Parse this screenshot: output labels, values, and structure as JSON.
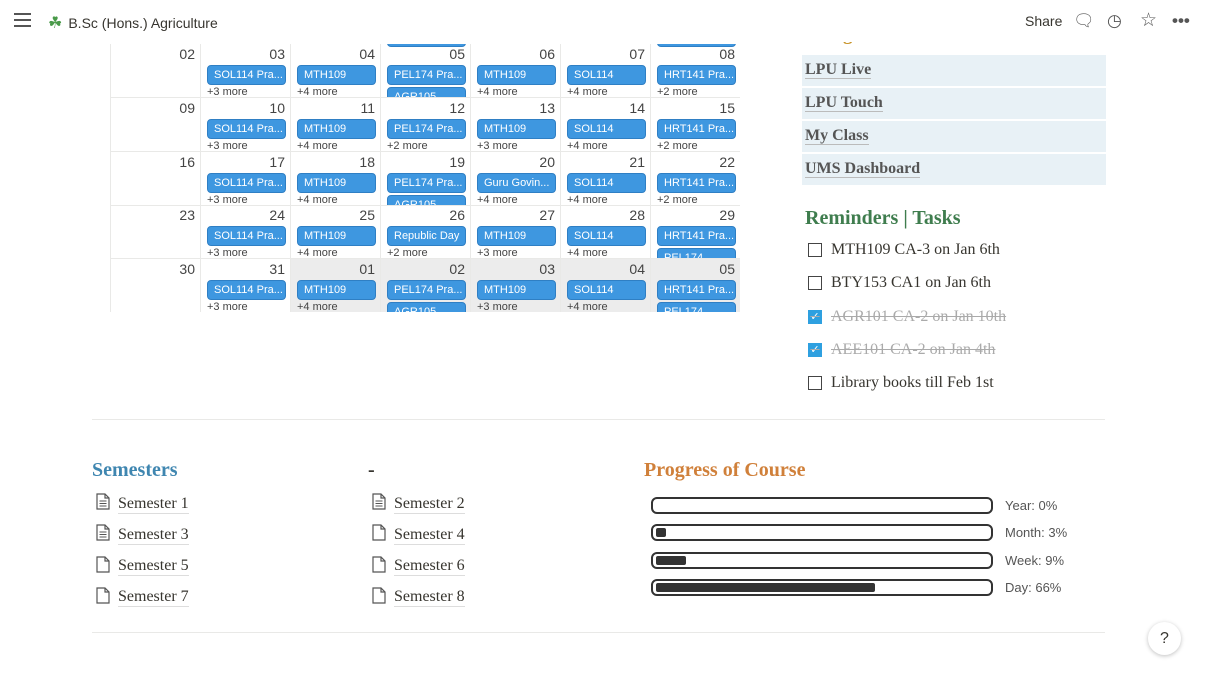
{
  "topbar": {
    "title": "B.Sc (Hons.) Agriculture",
    "share": "Share",
    "icons": [
      "menu-icon",
      "clover-icon",
      "comment-icon",
      "history-icon",
      "star-icon",
      "more-icon"
    ]
  },
  "calendar": {
    "event_color": "#3e97e0",
    "weeks": [
      [
        {
          "day": "02"
        },
        {
          "day": "03",
          "event": "SOL114 Pra...",
          "more": "+3 more"
        },
        {
          "day": "04",
          "event": "MTH109",
          "more": "+4 more"
        },
        {
          "day": "05",
          "event": "PEL174 Pra...",
          "extra": "AGR105"
        },
        {
          "day": "06",
          "event": "MTH109",
          "more": "+4 more"
        },
        {
          "day": "07",
          "event": "SOL114",
          "more": "+4 more"
        },
        {
          "day": "08",
          "event": "HRT141 Pra...",
          "more": "+2 more"
        }
      ],
      [
        {
          "day": "09"
        },
        {
          "day": "10",
          "event": "SOL114 Pra...",
          "more": "+3 more"
        },
        {
          "day": "11",
          "event": "MTH109",
          "more": "+4 more"
        },
        {
          "day": "12",
          "event": "PEL174 Pra...",
          "more": "+2 more"
        },
        {
          "day": "13",
          "event": "MTH109",
          "more": "+3 more"
        },
        {
          "day": "14",
          "event": "SOL114",
          "more": "+4 more"
        },
        {
          "day": "15",
          "event": "HRT141 Pra...",
          "more": "+2 more"
        }
      ],
      [
        {
          "day": "16"
        },
        {
          "day": "17",
          "event": "SOL114 Pra...",
          "more": "+3 more"
        },
        {
          "day": "18",
          "event": "MTH109",
          "more": "+4 more"
        },
        {
          "day": "19",
          "event": "PEL174 Pra...",
          "extra": "AGR105"
        },
        {
          "day": "20",
          "event": "Guru Govin...",
          "more": "+4 more"
        },
        {
          "day": "21",
          "event": "SOL114",
          "more": "+4 more"
        },
        {
          "day": "22",
          "event": "HRT141 Pra...",
          "more": "+2 more"
        }
      ],
      [
        {
          "day": "23"
        },
        {
          "day": "24",
          "event": "SOL114 Pra...",
          "more": "+3 more"
        },
        {
          "day": "25",
          "event": "MTH109",
          "more": "+4 more"
        },
        {
          "day": "26",
          "event": "Republic Day",
          "more": "+2 more"
        },
        {
          "day": "27",
          "event": "MTH109",
          "more": "+3 more"
        },
        {
          "day": "28",
          "event": "SOL114",
          "more": "+4 more"
        },
        {
          "day": "29",
          "event": "HRT141 Pra...",
          "extra": "PEL174"
        }
      ],
      [
        {
          "day": "30"
        },
        {
          "day": "31",
          "event": "SOL114 Pra...",
          "more": "+3 more"
        },
        {
          "day": "01",
          "event": "MTH109",
          "more": "+4 more",
          "out": true
        },
        {
          "day": "02",
          "event": "PEL174 Pra...",
          "extra": "AGR105",
          "out": true
        },
        {
          "day": "03",
          "event": "MTH109",
          "more": "+3 more",
          "out": true
        },
        {
          "day": "04",
          "event": "SOL114",
          "more": "+4 more",
          "out": true
        },
        {
          "day": "05",
          "event": "HRT141 Pra...",
          "extra": "PEL174",
          "out": true
        }
      ]
    ]
  },
  "navigation": {
    "heading": "Navigation",
    "links": [
      "LPU Live",
      "LPU Touch",
      "My Class",
      "UMS Dashboard"
    ]
  },
  "reminders": {
    "heading": "Reminders | Tasks",
    "items": [
      {
        "text": "MTH109 CA-3 on Jan 6th",
        "done": false
      },
      {
        "text": "BTY153 CA1 on Jan 6th",
        "done": false
      },
      {
        "text": "AGR101 CA-2 on Jan 10th",
        "done": true
      },
      {
        "text": "AEE101 CA-2 on Jan 4th",
        "done": true
      },
      {
        "text": "Library books till Feb 1st",
        "done": false
      }
    ]
  },
  "semesters": {
    "heading": "Semesters",
    "heading2": "-",
    "items": [
      {
        "label": "Semester 1",
        "has_content": true
      },
      {
        "label": "Semester 2",
        "has_content": true
      },
      {
        "label": "Semester 3",
        "has_content": true
      },
      {
        "label": "Semester 4",
        "has_content": false
      },
      {
        "label": "Semester 5",
        "has_content": false
      },
      {
        "label": "Semester 6",
        "has_content": false
      },
      {
        "label": "Semester 7",
        "has_content": false
      },
      {
        "label": "Semester 8",
        "has_content": false
      }
    ]
  },
  "progress": {
    "heading": "Progress of Course",
    "bars": [
      {
        "label": "Year: 0%",
        "percent": 0
      },
      {
        "label": "Month: 3%",
        "percent": 3
      },
      {
        "label": "Week: 9%",
        "percent": 9
      },
      {
        "label": "Day: 66%",
        "percent": 66
      }
    ]
  },
  "help": "?",
  "colors": {
    "semesters_heading": "#3f86b0",
    "reminders_heading": "#3f7d4e",
    "progress_heading": "#d0803a",
    "navigation_heading": "#c8942a"
  }
}
